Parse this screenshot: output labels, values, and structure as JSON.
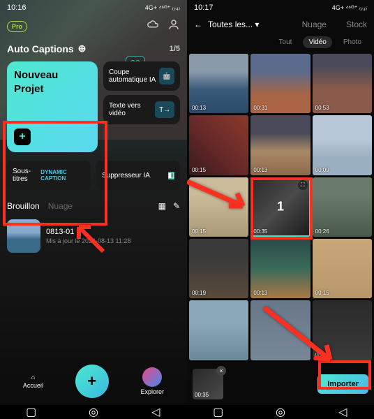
{
  "left": {
    "time": "10:16",
    "signal": "4G+ ⁴⁶ᴳ⁺ ₍₇₄₎",
    "pro": "Pro",
    "cc": "CC",
    "ai": "AI",
    "autoCaptions": "Auto Captions",
    "pager": "1/5",
    "newProject": "Nouveau Projet",
    "card1": "Coupe automatique IA",
    "card2": "Texte vers vidéo",
    "sousTitres": "Sous-titres",
    "dynamic": "DYNAMIC CAPTION",
    "suppressor": "Suppresseur IA",
    "brouillon": "Brouillon",
    "nuage": "Nuage",
    "draftName": "0813-01",
    "draftSub": "Mis à jour le 2024-08-13 11:28",
    "accueil": "Accueil",
    "explorer": "Explorer"
  },
  "right": {
    "time": "10:17",
    "signal": "4G+ ⁴⁶ᴳ⁺ ₍₇₃₎",
    "toutes": "Toutes les...",
    "nuage": "Nuage",
    "stock": "Stock",
    "tout": "Tout",
    "video": "Vidéo",
    "photo": "Photo",
    "durations": [
      "00:13",
      "00:31",
      "00:53",
      "00:15",
      "00:13",
      "00:09",
      "00:15",
      "00:35",
      "00:26",
      "00:19",
      "00:13",
      "00:15",
      "",
      "",
      "00:11"
    ],
    "selNum": "1",
    "selDur": "00:35",
    "importer": "Importer"
  }
}
